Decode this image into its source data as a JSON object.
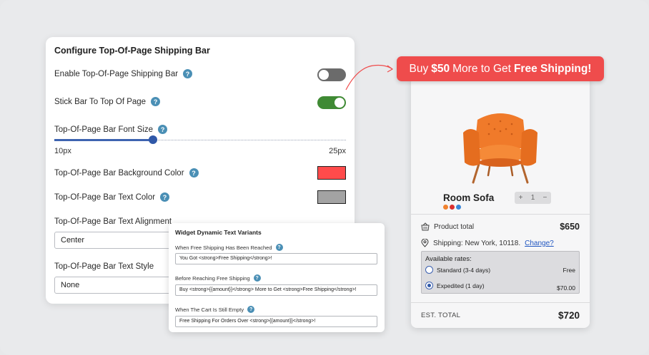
{
  "config": {
    "title": "Configure Top-Of-Page Shipping Bar",
    "enable_label": "Enable Top-Of-Page Shipping Bar",
    "enable_on": false,
    "stick_label": "Stick Bar To Top Of Page",
    "stick_on": true,
    "font_size_label": "Top-Of-Page Bar Font Size",
    "font_size_min": "10px",
    "font_size_max": "25px",
    "font_size_value_fraction": 0.33,
    "bg_color_label": "Top-Of-Page Bar Background Color",
    "bg_color": "#ff4b4b",
    "text_color_label": "Top-Of-Page Bar Text Color",
    "text_color": "#a3a3a3",
    "alignment_label": "Top-Of-Page Bar Text Alignment",
    "alignment_value": "Center",
    "style_label": "Top-Of-Page Bar Text Style",
    "style_value": "None"
  },
  "widget": {
    "title": "Widget Dynamic Text Variants",
    "reached_label": "When Free Shipping Has Been Reached",
    "reached_value": "You Got <strong>Free Shipping</strong>!",
    "before_label": "Before Reaching Free Shipping",
    "before_value": "Buy <strong>{{amount}}</strong> More to Get <strong>Free Shipping</strong>!",
    "empty_label": "When The Cart Is Still Empty",
    "empty_value": "Free Shipping For Orders Over <strong>{{amount}}</strong>!"
  },
  "banner": {
    "pre": "Buy",
    "amount": "$50",
    "mid": "More to Get",
    "highlight": "Free Shipping!"
  },
  "cart": {
    "product_name": "Room Sofa",
    "swatches": [
      "#f0822e",
      "#d92f2f",
      "#3b86d6"
    ],
    "qty_minus": "+",
    "qty_value": "1",
    "qty_plus": "−",
    "product_total_label": "Product total",
    "product_total": "$650",
    "shipping_prefix": "Shipping: New York, 10118.",
    "shipping_change": "Change?",
    "rates_title": "Available rates:",
    "rates": [
      {
        "label": "Standard (3-4 days)",
        "price": "Free",
        "selected": false
      },
      {
        "label": "Expedited (1 day)",
        "price": "$70.00",
        "selected": true
      }
    ],
    "est_total_label": "EST. TOTAL",
    "est_total": "$720"
  },
  "colors": {
    "banner_red": "#ef4c4c",
    "toggle_on": "#3f8a34",
    "toggle_off": "#6b6b6b",
    "slider_blue": "#2f58a8",
    "help_blue": "#4a8fb5",
    "chair_orange": "#f07a2a"
  }
}
